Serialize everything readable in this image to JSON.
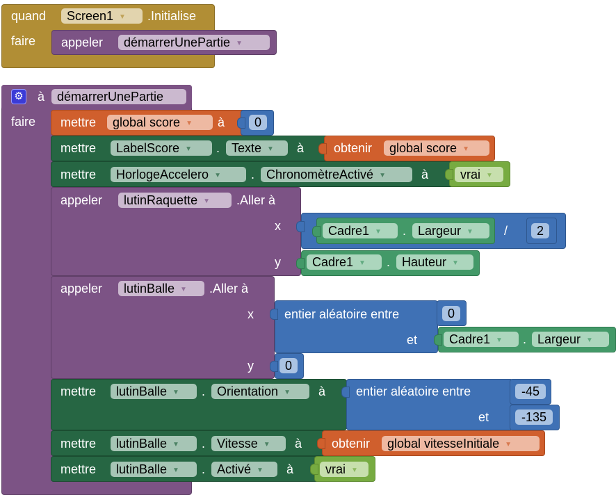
{
  "event_block": {
    "when_label": "quand",
    "component": "Screen1",
    "event": ".Initialise",
    "do_label": "faire",
    "call_label": "appeler",
    "procedure": "démarrerUnePartie"
  },
  "procedure_block": {
    "to_label": "à",
    "name": "démarrerUnePartie",
    "do_label": "faire",
    "gear_icon": "gear-icon",
    "statements": [
      {
        "kind": "set-global",
        "set_label": "mettre",
        "variable": "global score",
        "to_label": "à",
        "value": "0"
      },
      {
        "kind": "set-property",
        "set_label": "mettre",
        "component": "LabelScore",
        "dot": ".",
        "property": "Texte",
        "to_label": "à",
        "value": {
          "get_label": "obtenir",
          "variable": "global score"
        }
      },
      {
        "kind": "set-property",
        "set_label": "mettre",
        "component": "HorlogeAccelero",
        "dot": ".",
        "property": "ChronomètreActivé",
        "to_label": "à",
        "value": {
          "boolean": "vrai"
        }
      },
      {
        "kind": "call-method",
        "call_label": "appeler",
        "component": "lutinRaquette",
        "method": ".Aller à",
        "x_label": "x",
        "x": {
          "component": "Cadre1",
          "dot": ".",
          "property": "Largeur",
          "op": "/",
          "divisor": "2"
        },
        "y_label": "y",
        "y": {
          "component": "Cadre1",
          "dot": ".",
          "property": "Hauteur"
        }
      },
      {
        "kind": "call-method",
        "call_label": "appeler",
        "component": "lutinBalle",
        "method": ".Aller à",
        "x_label": "x",
        "x": {
          "random_label": "entier aléatoire entre",
          "from": "0",
          "and_label": "et",
          "to_component": "Cadre1",
          "dot": ".",
          "to_property": "Largeur"
        },
        "y_label": "y",
        "y": "0"
      },
      {
        "kind": "set-property",
        "set_label": "mettre",
        "component": "lutinBalle",
        "dot": ".",
        "property": "Orientation",
        "to_label": "à",
        "value": {
          "random_label": "entier aléatoire entre",
          "from": "-45",
          "and_label": "et",
          "to": "-135"
        }
      },
      {
        "kind": "set-property",
        "set_label": "mettre",
        "component": "lutinBalle",
        "dot": ".",
        "property": "Vitesse",
        "to_label": "à",
        "value": {
          "get_label": "obtenir",
          "variable": "global vitesseInitiale"
        }
      },
      {
        "kind": "set-property",
        "set_label": "mettre",
        "component": "lutinBalle",
        "dot": ".",
        "property": "Activé",
        "to_label": "à",
        "value": {
          "boolean": "vrai"
        }
      }
    ]
  },
  "dropdown_arrow": "▼",
  "colors": {
    "event": "#b18e35",
    "procedure": "#7c5385",
    "variable": "#d05f2d",
    "math": "#3f71b5",
    "component": "#266643",
    "component_getter": "#439968",
    "logic": "#77ab41"
  }
}
